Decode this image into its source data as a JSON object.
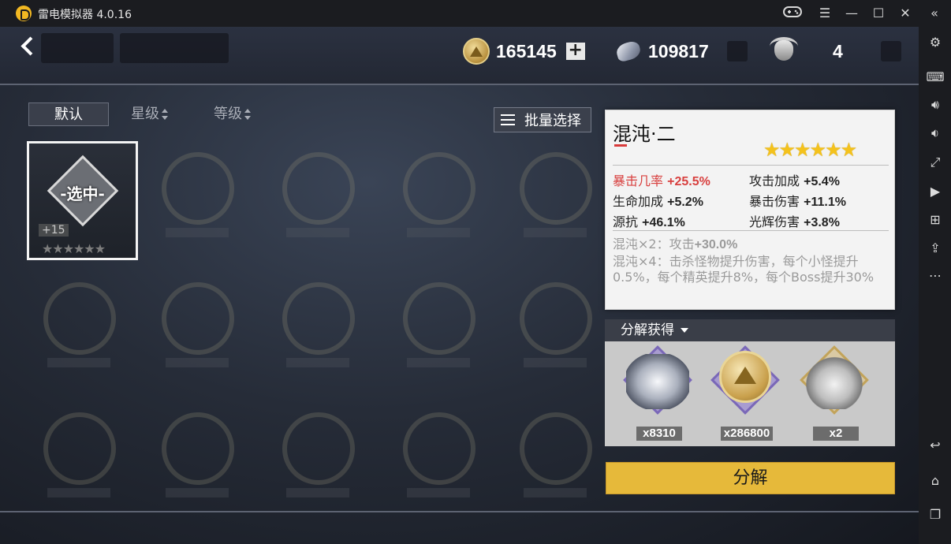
{
  "window": {
    "title": "雷电模拟器 4.0.16"
  },
  "currencies": {
    "gold": "165145",
    "crystal": "109817",
    "skull": "4"
  },
  "tabs": {
    "default": "默认",
    "star": "星级",
    "level": "等级"
  },
  "batch_select": "批量选择",
  "selected_item": {
    "label": "-选中-",
    "level": "+15",
    "stars": "★★★★★★"
  },
  "info": {
    "name": "混沌·二",
    "stars": "★★★★★★",
    "stats": [
      {
        "name": "暴击几率",
        "value": "+25.5%"
      },
      {
        "name": "攻击加成",
        "value": "+5.4%"
      },
      {
        "name": "生命加成",
        "value": "+5.2%"
      },
      {
        "name": "暴击伤害",
        "value": "+11.1%"
      },
      {
        "name": "源抗",
        "value": "+46.1%"
      },
      {
        "name": "光辉伤害",
        "value": "+3.8%"
      }
    ],
    "set2": {
      "prefix": "混沌×2：攻击",
      "value": "+30.0%"
    },
    "set4": "混沌×4：击杀怪物提升伤害，每个小怪提升0.5%，每个精英提升8%，每个Boss提升30%"
  },
  "rewards": {
    "header": "分解获得",
    "items": [
      {
        "icon": "dragon-crystal-icon",
        "count": "x8310"
      },
      {
        "icon": "gold-coin-icon",
        "count": "x286800"
      },
      {
        "icon": "skull-mask-icon",
        "count": "x2"
      }
    ]
  },
  "decompose_button": "分解",
  "colors": {
    "accent_gold": "#e6b93a",
    "crit_red": "#d8403f",
    "star_yellow": "#f4c21c"
  }
}
